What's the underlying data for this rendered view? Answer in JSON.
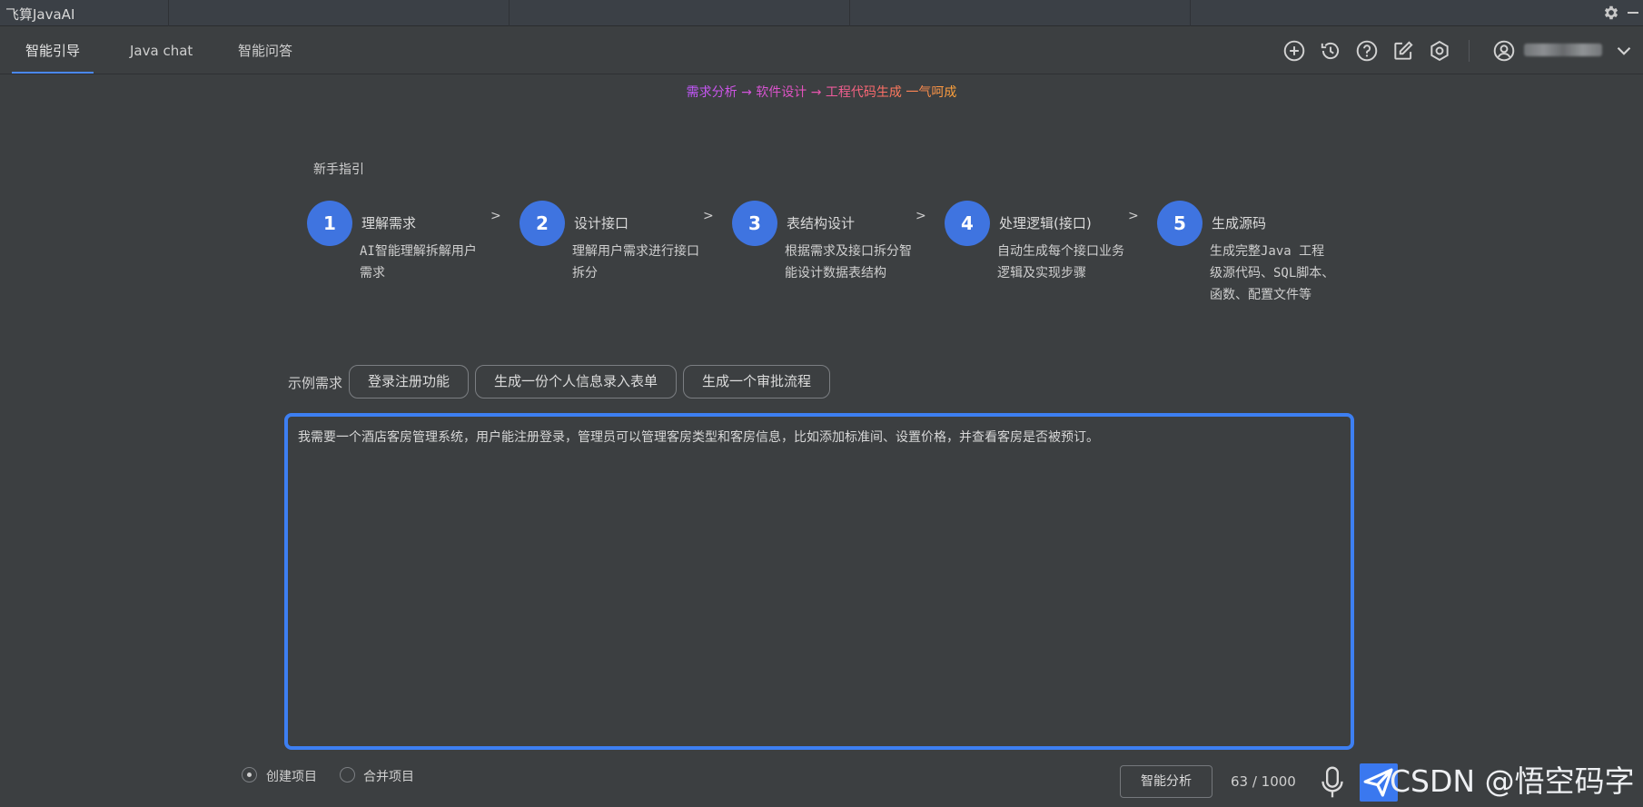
{
  "app": {
    "title": "飞算JavaAI"
  },
  "nav": {
    "tabs": [
      {
        "label": "智能引导",
        "active": true
      },
      {
        "label": "Java chat",
        "active": false
      },
      {
        "label": "智能问答",
        "active": false
      }
    ],
    "icons": [
      "plus-circle-icon",
      "history-icon",
      "help-icon",
      "edit-icon",
      "settings-hex-icon",
      "user-icon",
      "chevron-down-icon"
    ]
  },
  "tagline": "需求分析 → 软件设计 → 工程代码生成 一气呵成",
  "guide": {
    "title": "新手指引",
    "steps": [
      {
        "number": "1",
        "name": "理解需求",
        "desc": "AI智能理解拆解用户需求"
      },
      {
        "number": "2",
        "name": "设计接口",
        "desc": "理解用户需求进行接口拆分"
      },
      {
        "number": "3",
        "name": "表结构设计",
        "desc": "根据需求及接口拆分智能设计数据表结构"
      },
      {
        "number": "4",
        "name": "处理逻辑(接口)",
        "desc": "自动生成每个接口业务逻辑及实现步骤"
      },
      {
        "number": "5",
        "name": "生成源码",
        "desc": "生成完整Java 工程级源代码、SQL脚本、函数、配置文件等"
      }
    ],
    "arrow": ">"
  },
  "examples": {
    "label": "示例需求",
    "items": [
      "登录注册功能",
      "生成一份个人信息录入表单",
      "生成一个审批流程"
    ]
  },
  "input": {
    "value": "我需要一个酒店客房管理系统，用户能注册登录，管理员可以管理客房类型和客房信息，比如添加标准间、设置价格，并查看客房是否被预订。"
  },
  "footer": {
    "options": [
      {
        "label": "创建项目",
        "checked": true
      },
      {
        "label": "合并项目",
        "checked": false
      }
    ],
    "analyze_label": "智能分析",
    "counter": "63 / 1000"
  },
  "watermark": "CSDN @悟空码字",
  "colors": {
    "accent": "#3d7ff2",
    "step_circle": "#3f74e0",
    "background": "#3c3f41"
  }
}
